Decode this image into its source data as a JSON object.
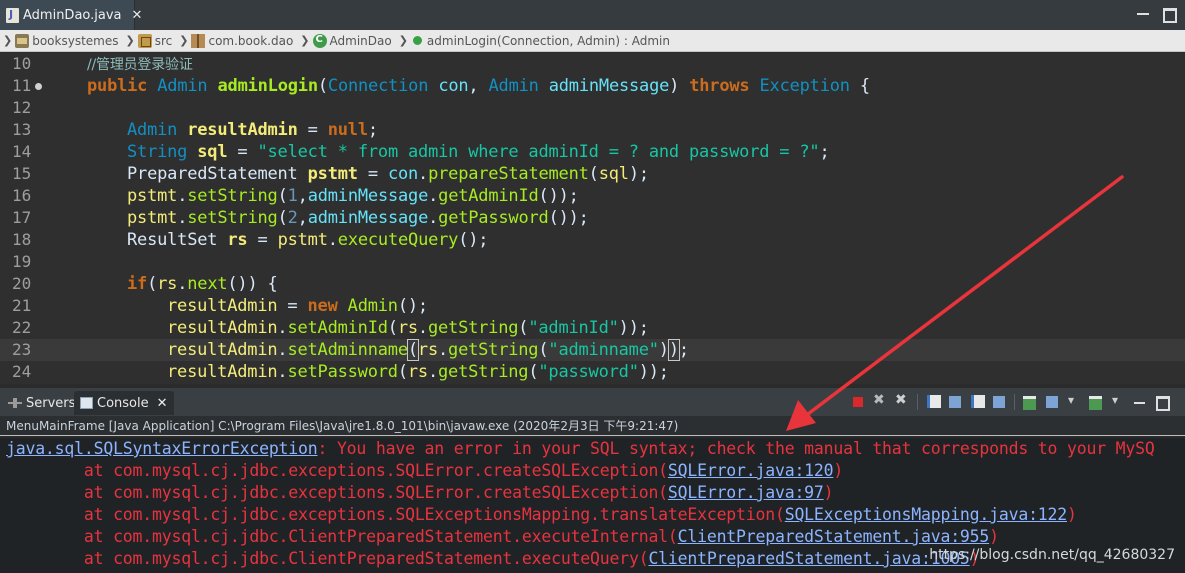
{
  "editor_tab": {
    "title": "AdminDao.java",
    "close": "✕"
  },
  "breadcrumb": {
    "project": "booksystemes",
    "src": "src",
    "package": "com.book.dao",
    "class": "AdminDao",
    "method": "adminLogin(Connection, Admin) : Admin"
  },
  "code_lines": [
    {
      "num": "10",
      "text": "//管理员登录验证"
    },
    {
      "num": "11",
      "text": "public Admin adminLogin(Connection con, Admin adminMessage) throws Exception {"
    },
    {
      "num": "12",
      "text": ""
    },
    {
      "num": "13",
      "text": "Admin resultAdmin = null;"
    },
    {
      "num": "14",
      "text": "String sql = \"select * from admin where adminId = ? and password = ?\";"
    },
    {
      "num": "15",
      "text": "PreparedStatement pstmt = con.prepareStatement(sql);"
    },
    {
      "num": "16",
      "text": "pstmt.setString(1,adminMessage.getAdminId());"
    },
    {
      "num": "17",
      "text": "pstmt.setString(2,adminMessage.getPassword());"
    },
    {
      "num": "18",
      "text": "ResultSet rs = pstmt.executeQuery();"
    },
    {
      "num": "19",
      "text": ""
    },
    {
      "num": "20",
      "text": "if(rs.next()) {"
    },
    {
      "num": "21",
      "text": "resultAdmin = new Admin();"
    },
    {
      "num": "22",
      "text": "resultAdmin.setAdminId(rs.getString(\"adminId\"));"
    },
    {
      "num": "23",
      "text": "resultAdmin.setAdminname(rs.getString(\"adminname\"));"
    },
    {
      "num": "24",
      "text": "resultAdmin.setPassword(rs.getString(\"password\"));"
    }
  ],
  "console": {
    "servers_tab": "Servers",
    "console_tab": "Console",
    "tab_close": "✕",
    "description": "MenuMainFrame [Java Application] C:\\Program Files\\Java\\jre1.8.0_101\\bin\\javaw.exe (2020年2月3日 下午9:21:47)",
    "output": [
      {
        "prefix": "",
        "link": "java.sql.SQLSyntaxErrorException",
        "suffix": ": You have an error in your SQL syntax; check the manual that corresponds to your MySQ"
      },
      {
        "prefix": "\tat com.mysql.cj.jdbc.exceptions.SQLError.createSQLException(",
        "link": "SQLError.java:120",
        "suffix": ")"
      },
      {
        "prefix": "\tat com.mysql.cj.jdbc.exceptions.SQLError.createSQLException(",
        "link": "SQLError.java:97",
        "suffix": ")"
      },
      {
        "prefix": "\tat com.mysql.cj.jdbc.exceptions.SQLExceptionsMapping.translateException(",
        "link": "SQLExceptionsMapping.java:122",
        "suffix": ")"
      },
      {
        "prefix": "\tat com.mysql.cj.jdbc.ClientPreparedStatement.executeInternal(",
        "link": "ClientPreparedStatement.java:955",
        "suffix": ")"
      },
      {
        "prefix": "\tat com.mysql.cj.jdbc.ClientPreparedStatement.executeQuery(",
        "link": "ClientPreparedStatement.java:1005",
        "suffix": ")"
      }
    ]
  },
  "watermark": "https://blog.csdn.net/qq_42680327",
  "colors": {
    "annotation_arrow": "#e8343a",
    "error_text": "#e8333e",
    "link": "#8cb4ff"
  }
}
